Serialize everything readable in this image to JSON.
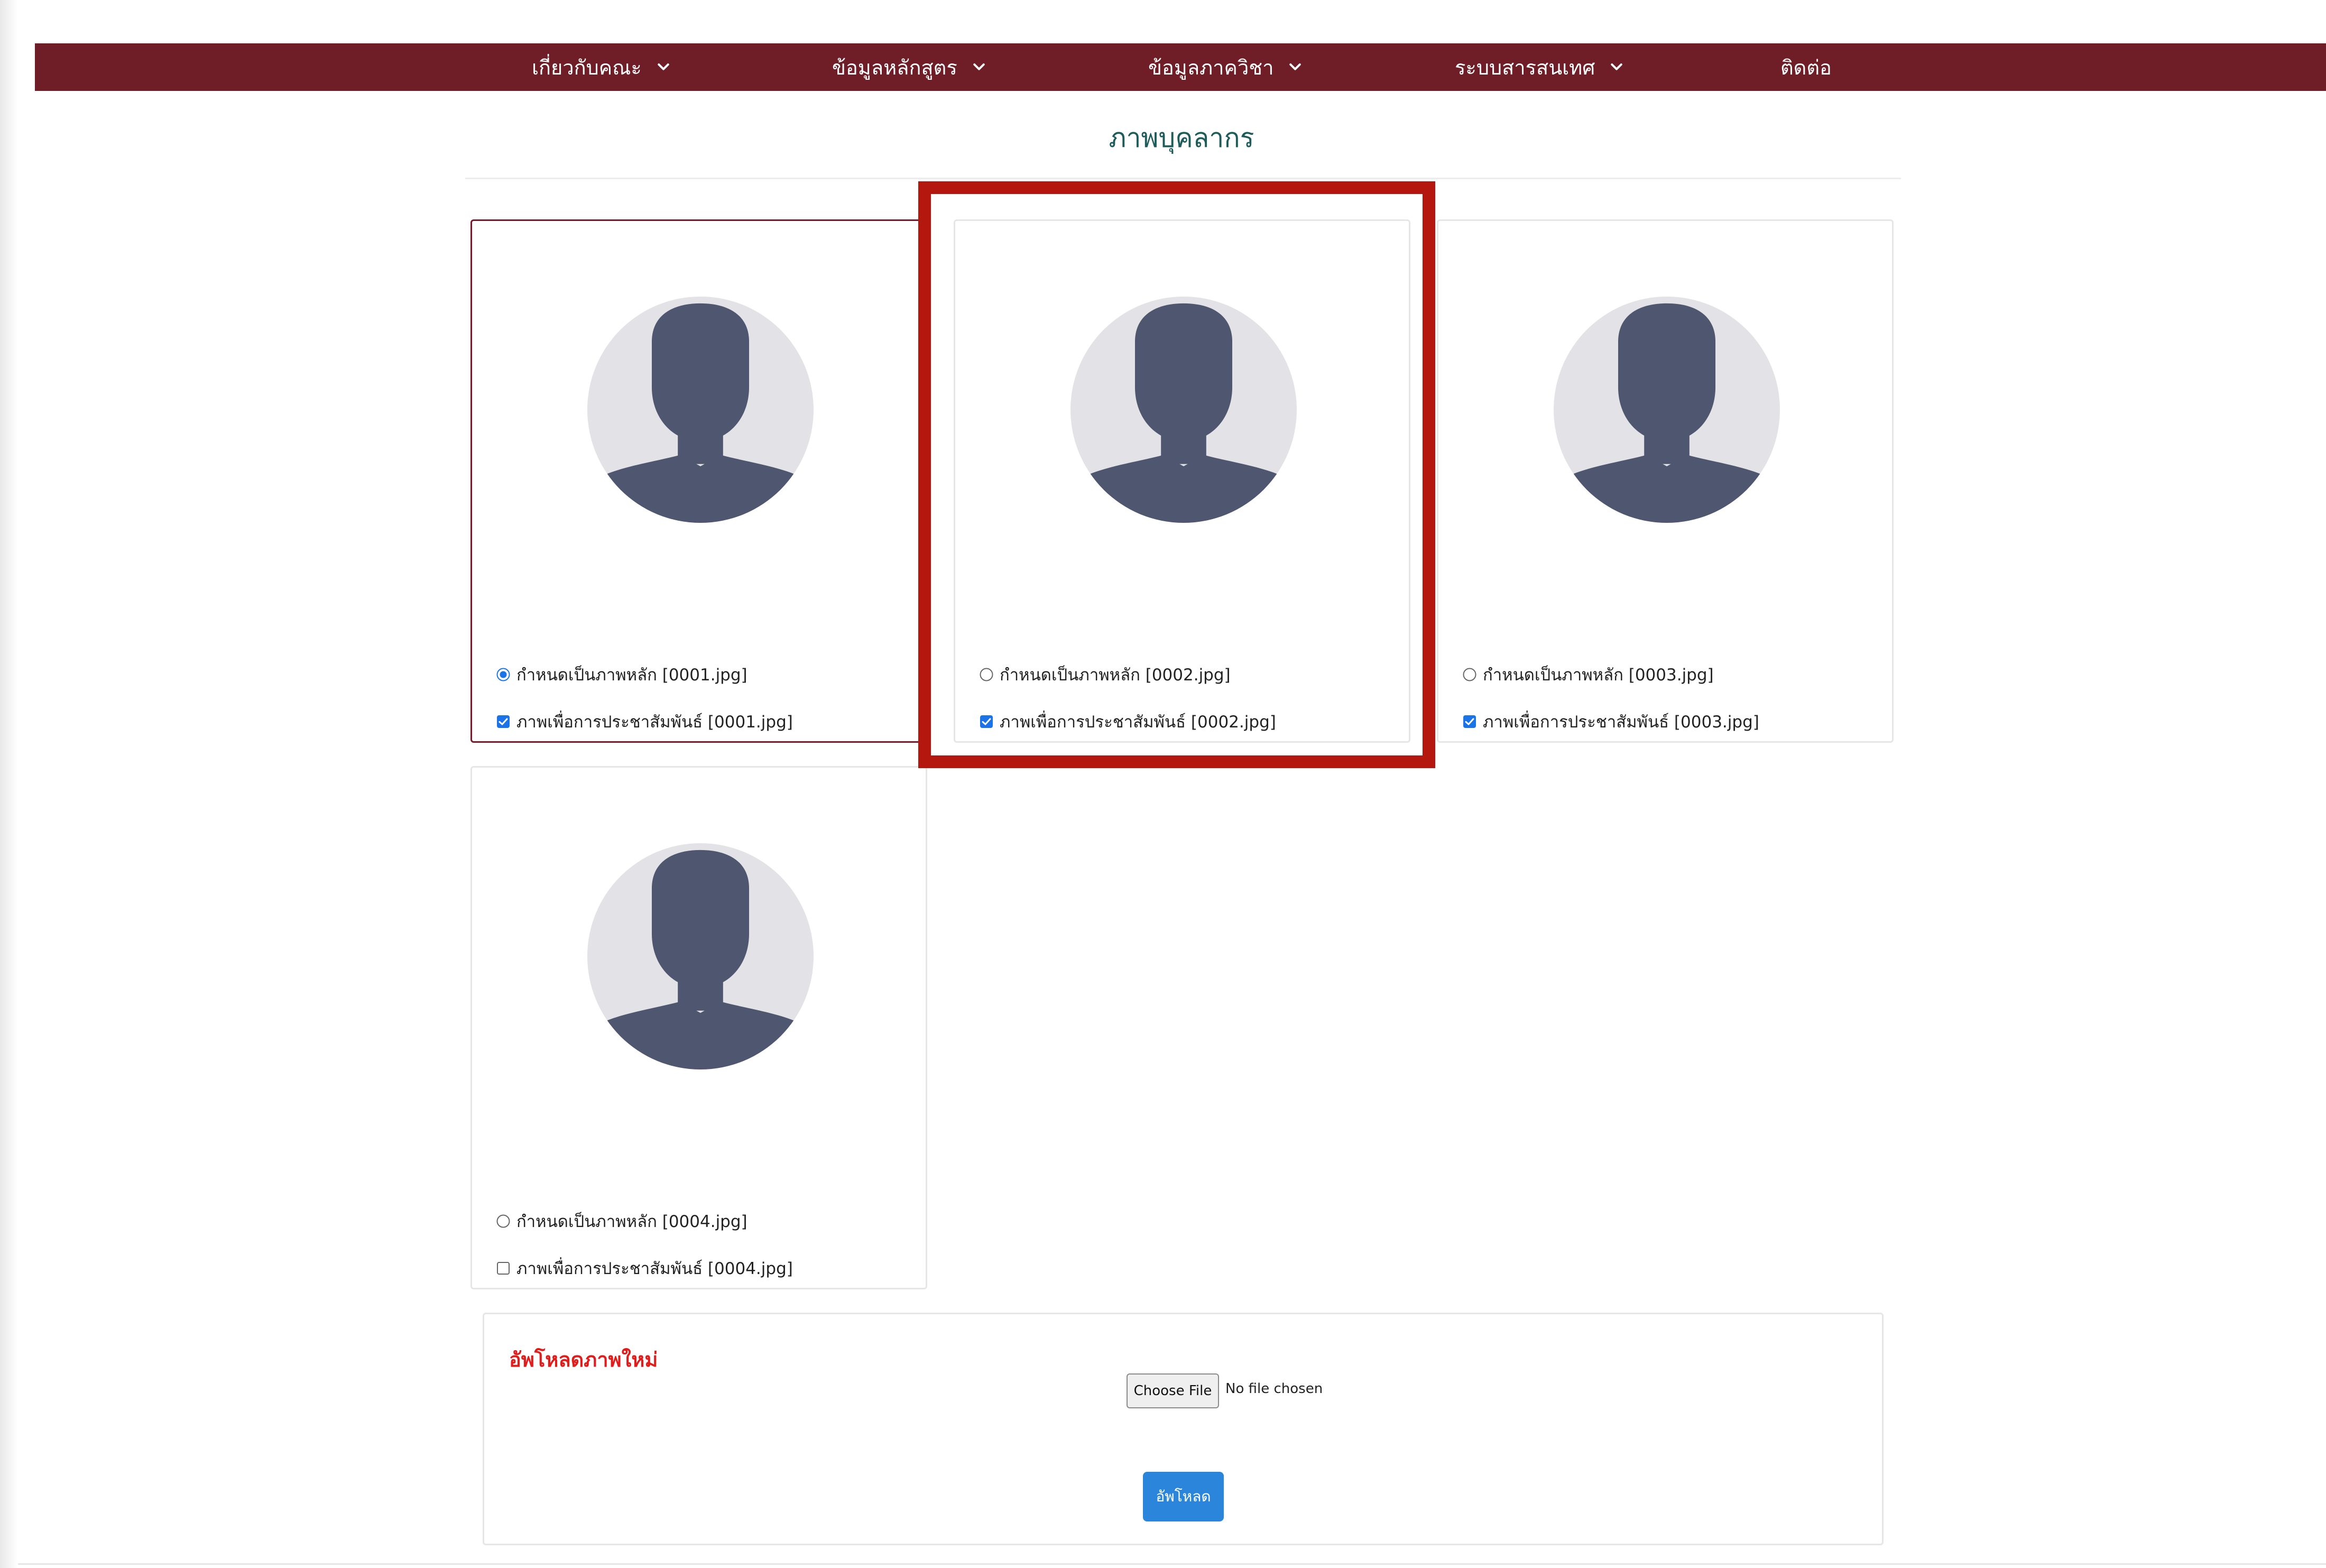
{
  "nav": {
    "items": [
      {
        "label": "เกี่ยวกับคณะ",
        "has_dropdown": true
      },
      {
        "label": "ข้อมูลหลักสูตร",
        "has_dropdown": true
      },
      {
        "label": "ข้อมูลภาควิชา",
        "has_dropdown": true
      },
      {
        "label": "ระบบสารสนเทศ",
        "has_dropdown": true
      },
      {
        "label": "ติดต่อ",
        "has_dropdown": false
      }
    ],
    "background_color": "#6f1d26"
  },
  "page": {
    "title": "ภาพบุคลากร"
  },
  "photos": [
    {
      "set_main_label": "กำหนดเป็นภาพหลัก [0001.jpg]",
      "pr_label": "ภาพเพื่อการประชาสัมพันธ์ [0001.jpg]",
      "is_main": true,
      "is_pr": true,
      "avatar_icon": "user-silhouette-icon"
    },
    {
      "set_main_label": "กำหนดเป็นภาพหลัก [0002.jpg]",
      "pr_label": "ภาพเพื่อการประชาสัมพันธ์ [0002.jpg]",
      "is_main": false,
      "is_pr": true,
      "avatar_icon": "user-silhouette-icon"
    },
    {
      "set_main_label": "กำหนดเป็นภาพหลัก [0003.jpg]",
      "pr_label": "ภาพเพื่อการประชาสัมพันธ์ [0003.jpg]",
      "is_main": false,
      "is_pr": true,
      "avatar_icon": "user-silhouette-icon"
    },
    {
      "set_main_label": "กำหนดเป็นภาพหลัก [0004.jpg]",
      "pr_label": "ภาพเพื่อการประชาสัมพันธ์ [0004.jpg]",
      "is_main": false,
      "is_pr": false,
      "avatar_icon": "user-silhouette-icon"
    }
  ],
  "upload": {
    "heading": "อัพโหลดภาพใหม่",
    "choose_file_label": "Choose File",
    "file_status": "No file chosen",
    "submit_label": "อัพโหลด"
  },
  "colors": {
    "accent_red": "#b3170d",
    "selected_card_border": "#7a1a2a",
    "title_color": "#1d5c5a",
    "upload_heading": "#e21b1b",
    "button_blue": "#2b86db",
    "checkbox_blue": "#1a73e8"
  }
}
